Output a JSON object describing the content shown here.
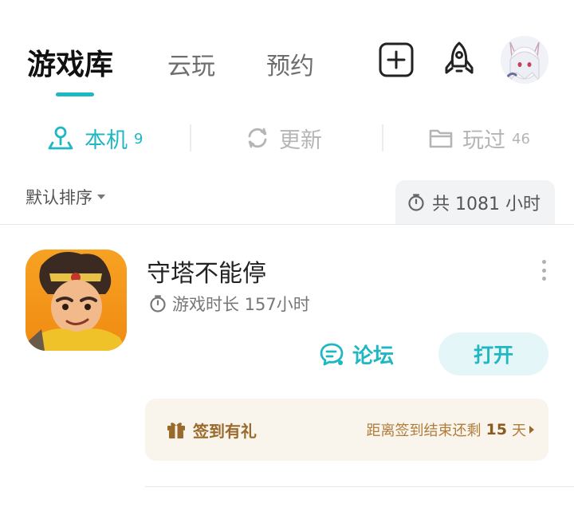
{
  "topnav": {
    "tabs": [
      {
        "label": "游戏库",
        "active": true
      },
      {
        "label": "云玩",
        "active": false
      },
      {
        "label": "预约",
        "active": false
      }
    ],
    "icons": [
      "add-icon",
      "rocket-icon",
      "avatar"
    ]
  },
  "subtabs": [
    {
      "label": "本机",
      "count": "9",
      "icon": "pin-icon",
      "active": true
    },
    {
      "label": "更新",
      "count": "",
      "icon": "refresh-icon",
      "active": false
    },
    {
      "label": "玩过",
      "count": "46",
      "icon": "folder-icon",
      "active": false
    }
  ],
  "sort": {
    "label": "默认排序"
  },
  "total": {
    "label": "共 1081 小时"
  },
  "game": {
    "title": "守塔不能停",
    "play_time": "游戏时长 157小时",
    "forum_label": "论坛",
    "open_label": "打开"
  },
  "checkin": {
    "title": "签到有礼",
    "prefix": "距离签到结束还剩",
    "days": "15",
    "suffix": "天"
  },
  "colors": {
    "accent": "#1fb7c3",
    "checkin_bg": "#f9f4ec",
    "checkin_text": "#9a6a2c"
  }
}
